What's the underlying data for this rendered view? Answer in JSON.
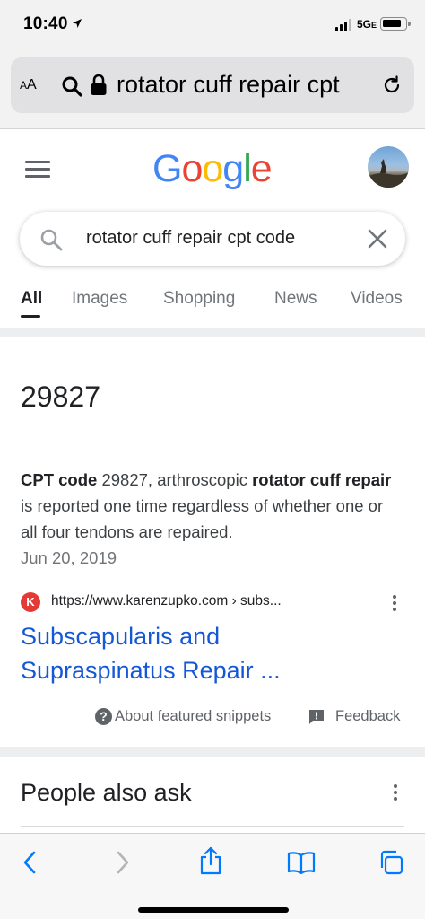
{
  "status_bar": {
    "time": "10:40",
    "network": "5G",
    "network_suffix": "E"
  },
  "safari": {
    "text_size_label_big": "A",
    "text_size_label_small": "A",
    "url_text": "rotator cuff repair cpt"
  },
  "google": {
    "logo_letters": [
      {
        "ch": "G",
        "color": "#4285F4"
      },
      {
        "ch": "o",
        "color": "#EA4335"
      },
      {
        "ch": "o",
        "color": "#FBBC05"
      },
      {
        "ch": "g",
        "color": "#4285F4"
      },
      {
        "ch": "l",
        "color": "#34A853"
      },
      {
        "ch": "e",
        "color": "#EA4335"
      }
    ],
    "search_query": "rotator cuff repair cpt code",
    "tabs": [
      "All",
      "Images",
      "Shopping",
      "News",
      "Videos"
    ]
  },
  "snippet": {
    "answer": "29827",
    "text_parts": [
      {
        "t": "CPT code",
        "bold": true
      },
      {
        "t": " 29827, arthroscopic ",
        "bold": false
      },
      {
        "t": "rotator cuff repair",
        "bold": true
      },
      {
        "t": " is reported one time regardless of whether one or all four tendons are repaired.",
        "bold": false
      }
    ],
    "date": "Jun 20, 2019",
    "favicon_letter": "K",
    "source_url": "https://www.karenzupko.com › subs...",
    "title": "Subscapularis and Supraspinatus Repair ...",
    "about_label": "About featured snippets",
    "feedback_label": "Feedback"
  },
  "people_also_ask": {
    "title": "People also ask"
  },
  "colors": {
    "link": "#1558d6",
    "accent_blue": "#007aff"
  },
  "icons": [
    "location-arrow-icon",
    "search-icon",
    "lock-icon",
    "reload-icon",
    "hamburger-icon",
    "clear-icon",
    "question-icon",
    "feedback-icon",
    "more-vert-icon",
    "back-icon",
    "forward-icon",
    "share-icon",
    "bookmarks-icon",
    "tabs-icon"
  ]
}
